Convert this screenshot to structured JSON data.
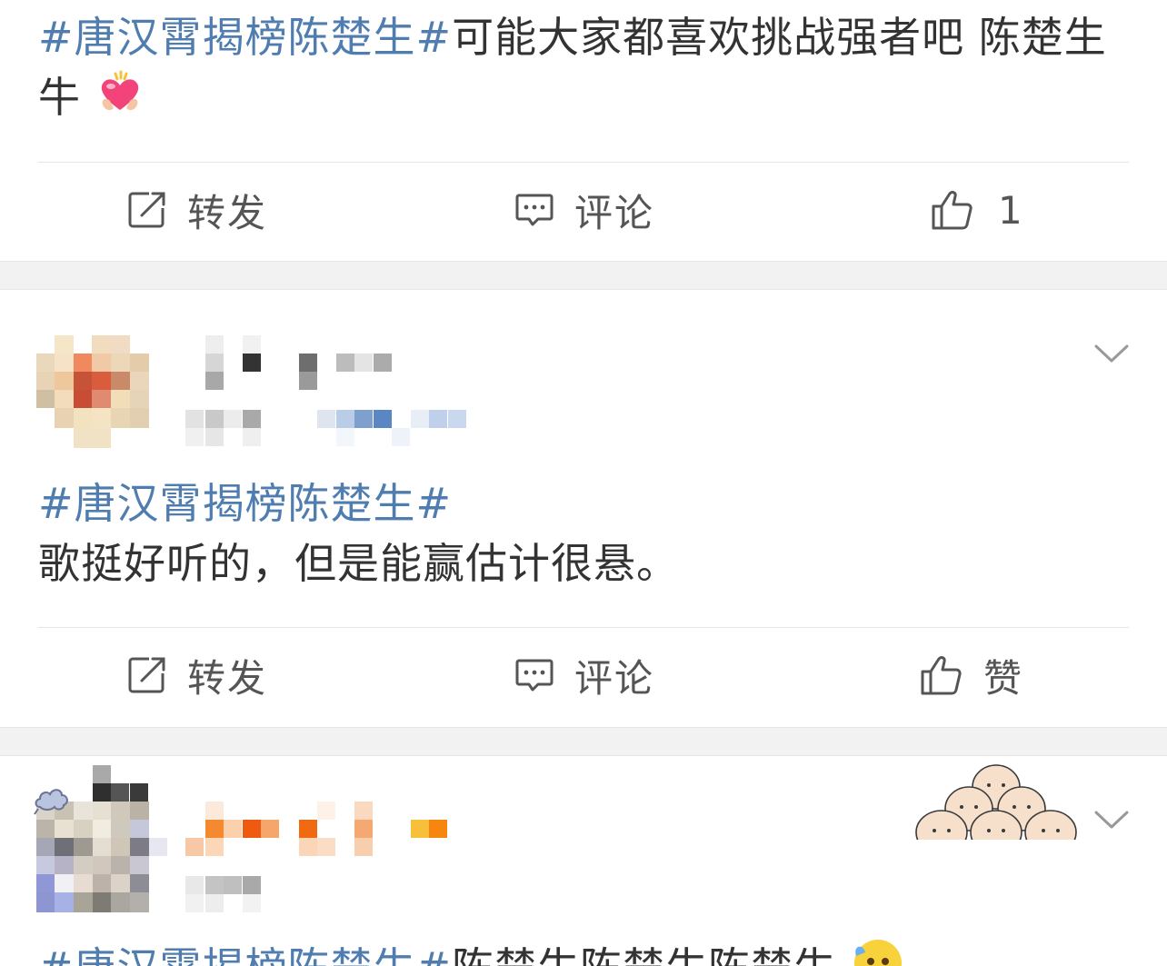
{
  "posts": [
    {
      "topic": "#唐汉霄揭榜陈楚生#",
      "body": "可能大家都喜欢挑战强者吧 陈楚生牛",
      "emoji": "heart-hands-emoji",
      "actions": {
        "repost": "转发",
        "comment": "评论",
        "like": "1"
      }
    },
    {
      "topic": "#唐汉霄揭榜陈楚生#",
      "body": "歌挺好听的，但是能赢估计很悬。",
      "actions": {
        "repost": "转发",
        "comment": "评论",
        "like": "赞"
      }
    },
    {
      "topic": "#唐汉霄揭榜陈楚生#",
      "body": "陈楚生陈楚生陈楚生",
      "emoji": "laughing-cry-emoji"
    }
  ],
  "icons": {
    "repost": "repost-icon",
    "comment": "comment-icon",
    "like": "thumbs-up-icon",
    "more": "chevron-down-icon"
  },
  "colors": {
    "topic": "#507daf",
    "text": "#333333",
    "separator": "#f2f2f2"
  }
}
